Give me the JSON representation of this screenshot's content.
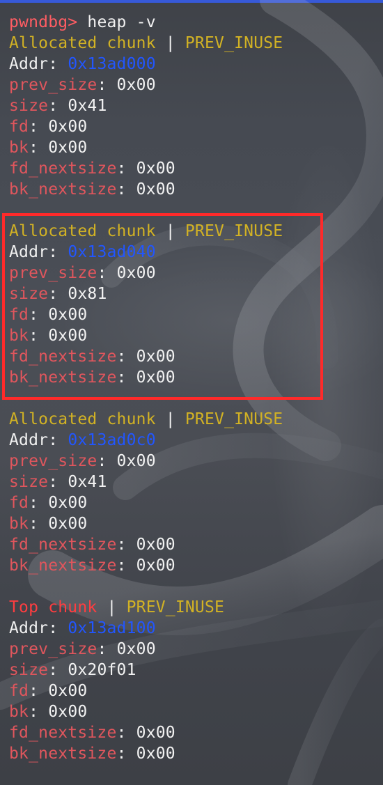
{
  "prompt": "pwndbg>",
  "command": "heap -v",
  "chunks": [
    {
      "title": "Allocated chunk",
      "flag": "PREV_INUSE",
      "addr_label": "Addr",
      "addr": "0x13ad000",
      "prev_size_label": "prev_size",
      "prev_size": "0x00",
      "size_label": "size",
      "size": "0x41",
      "fd_label": "fd",
      "fd": "0x00",
      "bk_label": "bk",
      "bk": "0x00",
      "fd_nextsize_label": "fd_nextsize",
      "fd_nextsize": "0x00",
      "bk_nextsize_label": "bk_nextsize",
      "bk_nextsize": "0x00"
    },
    {
      "title": "Allocated chunk",
      "flag": "PREV_INUSE",
      "addr_label": "Addr",
      "addr": "0x13ad040",
      "prev_size_label": "prev_size",
      "prev_size": "0x00",
      "size_label": "size",
      "size": "0x81",
      "fd_label": "fd",
      "fd": "0x00",
      "bk_label": "bk",
      "bk": "0x00",
      "fd_nextsize_label": "fd_nextsize",
      "fd_nextsize": "0x00",
      "bk_nextsize_label": "bk_nextsize",
      "bk_nextsize": "0x00"
    },
    {
      "title": "Allocated chunk",
      "flag": "PREV_INUSE",
      "addr_label": "Addr",
      "addr": "0x13ad0c0",
      "prev_size_label": "prev_size",
      "prev_size": "0x00",
      "size_label": "size",
      "size": "0x41",
      "fd_label": "fd",
      "fd": "0x00",
      "bk_label": "bk",
      "bk": "0x00",
      "fd_nextsize_label": "fd_nextsize",
      "fd_nextsize": "0x00",
      "bk_nextsize_label": "bk_nextsize",
      "bk_nextsize": "0x00"
    },
    {
      "title": "Top chunk",
      "flag": "PREV_INUSE",
      "addr_label": "Addr",
      "addr": "0x13ad100",
      "prev_size_label": "prev_size",
      "prev_size": "0x00",
      "size_label": "size",
      "size": "0x20f01",
      "fd_label": "fd",
      "fd": "0x00",
      "bk_label": "bk",
      "bk": "0x00",
      "fd_nextsize_label": "fd_nextsize",
      "fd_nextsize": "0x00",
      "bk_nextsize_label": "bk_nextsize",
      "bk_nextsize": "0x00"
    }
  ],
  "colors": {
    "prompt": "#ff5d63",
    "yellow": "#d2b224",
    "red": "#e0565d",
    "blue": "#2256ff",
    "highlight": "#ff2a2a",
    "topbar": "#3759d8"
  }
}
